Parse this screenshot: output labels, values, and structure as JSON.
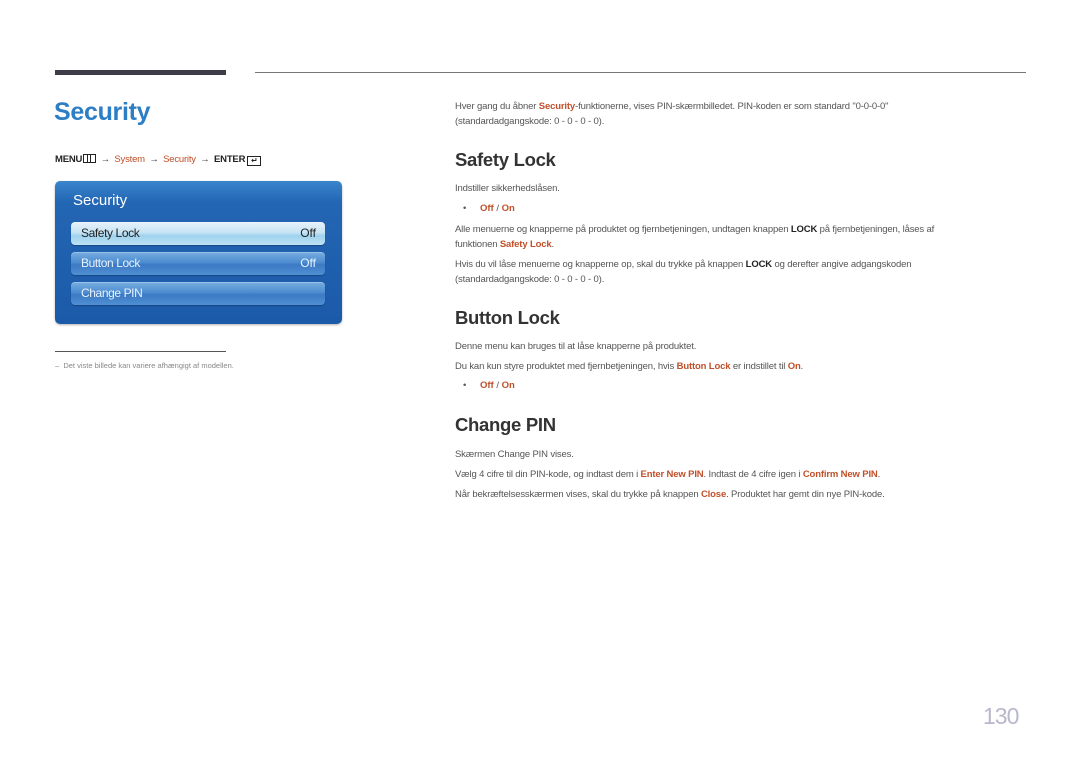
{
  "page": {
    "title": "Security",
    "page_number": "130",
    "footnote": "Det viste billede kan variere afhængigt af modellen."
  },
  "breadcrumb": {
    "menu": "MENU",
    "menu_icon": "menu-grid-icon",
    "arrow": "→",
    "system": "System",
    "security": "Security",
    "enter": "ENTER",
    "enter_icon": "enter-return-icon"
  },
  "osd": {
    "title": "Security",
    "items": [
      {
        "label": "Safety Lock",
        "value": "Off",
        "selected": true
      },
      {
        "label": "Button Lock",
        "value": "Off",
        "selected": false
      },
      {
        "label": "Change PIN",
        "value": "",
        "selected": false
      }
    ]
  },
  "intro": {
    "part1": "Hver gang du åbner ",
    "hl": "Security",
    "part2": "-funktionerne, vises PIN-skærmbilledet. PIN-koden er som standard \"0-0-0-0\"",
    "line2": "(standardadgangskode: 0 - 0 - 0 - 0)."
  },
  "safety_lock": {
    "heading": "Safety Lock",
    "desc": "Indstiller sikkerhedslåsen.",
    "option_off": "Off",
    "option_sep": " / ",
    "option_on": "On",
    "p1_a": "Alle menuerne og knapperne på produktet og fjernbetjeningen, undtagen knappen ",
    "p1_b": "LOCK",
    "p1_c": " på fjernbetjeningen, låses af",
    "p1_line2_a": "funktionen ",
    "p1_line2_hl": "Safety Lock",
    "p1_line2_c": ".",
    "p2_a": "Hvis du vil låse menuerne og knapperne op, skal du trykke på knappen ",
    "p2_b": "LOCK",
    "p2_c": " og derefter angive adgangskoden",
    "p2_line2": "(standardadgangskode: 0 - 0 - 0 - 0)."
  },
  "button_lock": {
    "heading": "Button Lock",
    "desc": "Denne menu kan bruges til at låse knapperne på produktet.",
    "p1_a": "Du kan kun styre produktet med fjernbetjeningen, hvis ",
    "p1_hl": "Button Lock",
    "p1_b": " er indstillet til ",
    "p1_hl2": "On",
    "p1_c": ".",
    "option_off": "Off",
    "option_sep": " / ",
    "option_on": "On"
  },
  "change_pin": {
    "heading": "Change PIN",
    "desc": "Skærmen Change PIN vises.",
    "p1_a": "Vælg 4 cifre til din PIN-kode, og indtast dem i ",
    "p1_hl": "Enter New PIN",
    "p1_b": ". Indtast de 4 cifre igen i ",
    "p1_hl2": "Confirm New PIN",
    "p1_c": ".",
    "p2_a": "Når bekræftelsesskærmen vises, skal du trykke på knappen ",
    "p2_hl": "Close",
    "p2_b": ". Produktet har gemt din nye PIN-kode."
  },
  "colors": {
    "title_blue": "#2d7ec4",
    "highlight_orange": "#c0502a",
    "osd_blue": "#1b5aa8"
  }
}
